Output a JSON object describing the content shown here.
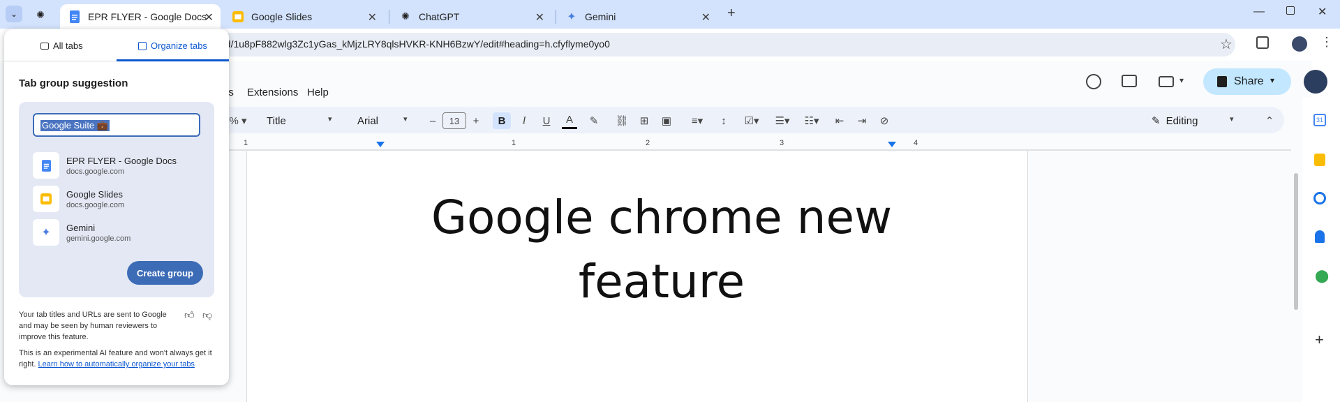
{
  "tabs": [
    {
      "title": "EPR FLYER - Google Docs",
      "icon": "google-docs-icon",
      "active": true
    },
    {
      "title": "Google Slides",
      "icon": "google-slides-icon",
      "active": false
    },
    {
      "title": "ChatGPT",
      "icon": "chatgpt-icon",
      "active": false
    },
    {
      "title": "Gemini",
      "icon": "gemini-icon",
      "active": false
    }
  ],
  "address": {
    "url_visible": "t/d/1u8pF882wlg3Zc1yGas_kMjzLRY8qlsHVKR-KNH6BzwY/edit#heading=h.cfyflyme0yo0"
  },
  "docs": {
    "menus": [
      "ls",
      "Extensions",
      "Help"
    ],
    "toolbar": {
      "zoom_suffix": "%",
      "style": "Title",
      "font": "Arial",
      "size": "13",
      "mode": "Editing"
    },
    "share_label": "Share",
    "ruler_numbers": [
      "1",
      "1",
      "2",
      "3",
      "4"
    ],
    "title_line1": "Google chrome new",
    "title_line2": "feature"
  },
  "popup": {
    "tab_all": "All tabs",
    "tab_organize": "Organize tabs",
    "heading": "Tab group suggestion",
    "group_name": "Google Suite 💼",
    "suggestions": [
      {
        "title": "EPR FLYER - Google Docs",
        "url": "docs.google.com",
        "icon": "google-docs-icon"
      },
      {
        "title": "Google Slides",
        "url": "docs.google.com",
        "icon": "google-slides-icon"
      },
      {
        "title": "Gemini",
        "url": "gemini.google.com",
        "icon": "gemini-icon"
      }
    ],
    "create_button": "Create group",
    "disclaimer1": "Your tab titles and URLs are sent to Google and may be seen by human reviewers to improve this feature.",
    "disclaimer2_prefix": "This is an experimental AI feature and won't always get it right.",
    "disclaimer2_link": "Learn how to automatically organize your tabs"
  },
  "colors": {
    "tabstrip": "#d3e3fd",
    "accent": "#3d6cb7",
    "share": "#c2e7ff"
  }
}
